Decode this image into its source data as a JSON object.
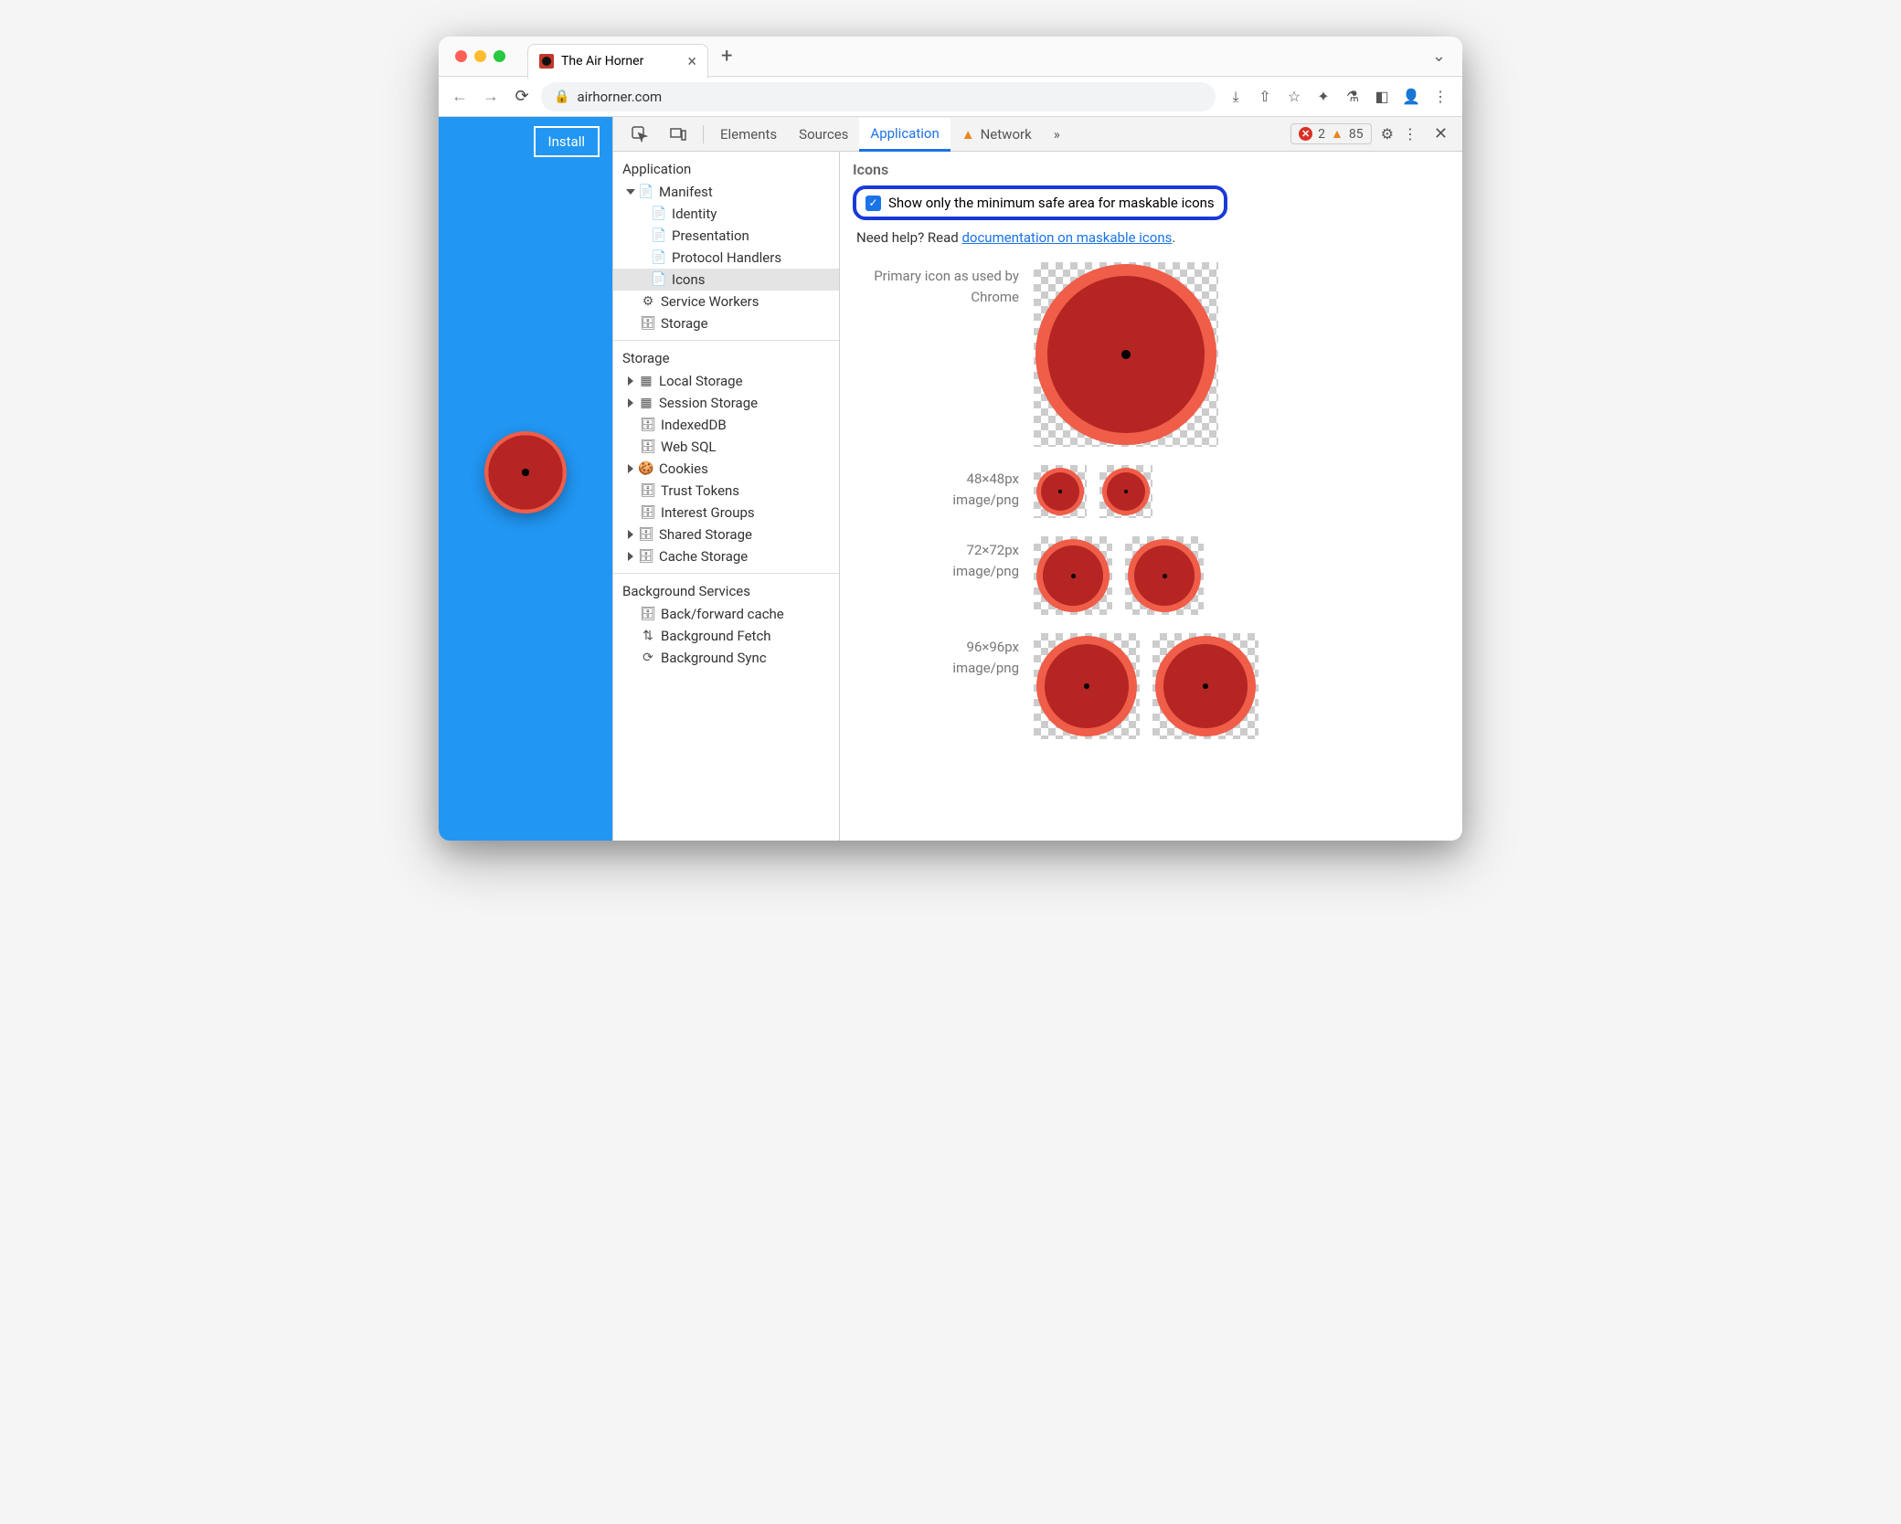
{
  "browser": {
    "tab_title": "The Air Horner",
    "url": "airhorner.com",
    "page_install_button": "Install"
  },
  "devtools": {
    "tabs": [
      "Elements",
      "Sources",
      "Application",
      "Network"
    ],
    "active_tab": "Application",
    "errors": "2",
    "warnings": "85",
    "sidebar": {
      "section1": "Application",
      "manifest": "Manifest",
      "manifest_items": [
        "Identity",
        "Presentation",
        "Protocol Handlers",
        "Icons"
      ],
      "manifest_selected": "Icons",
      "service_workers": "Service Workers",
      "storage_top": "Storage",
      "section2": "Storage",
      "storage_items": [
        "Local Storage",
        "Session Storage",
        "IndexedDB",
        "Web SQL",
        "Cookies",
        "Trust Tokens",
        "Interest Groups",
        "Shared Storage",
        "Cache Storage"
      ],
      "section3": "Background Services",
      "bg_items": [
        "Back/forward cache",
        "Background Fetch",
        "Background Sync"
      ]
    },
    "main": {
      "heading": "Icons",
      "checkbox_label": "Show only the minimum safe area for maskable icons",
      "help_prefix": "Need help? Read ",
      "help_link": "documentation on maskable icons",
      "primary_label_l1": "Primary icon as used by",
      "primary_label_l2": "Chrome",
      "rows": [
        {
          "size": "48×48px",
          "mime": "image/png",
          "count": 2
        },
        {
          "size": "72×72px",
          "mime": "image/png",
          "count": 2
        },
        {
          "size": "96×96px",
          "mime": "image/png",
          "count": 2
        }
      ]
    }
  }
}
